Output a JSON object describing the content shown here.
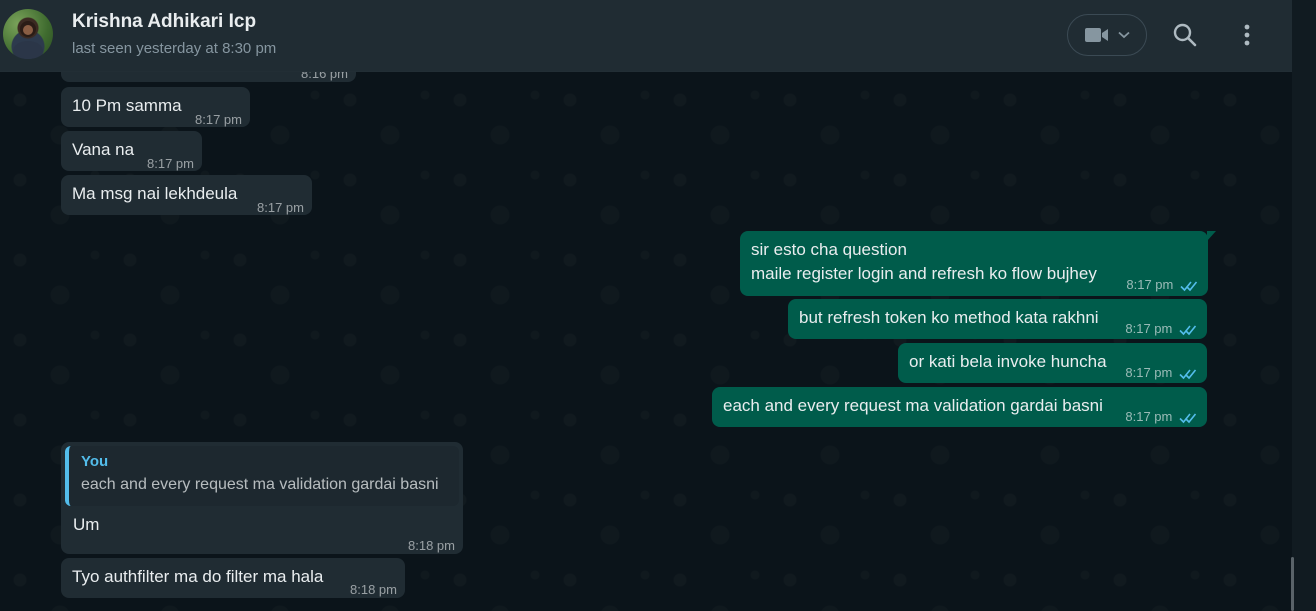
{
  "header": {
    "contact_name": "Krishna Adhikari Icp",
    "status": "last seen yesterday at 8:30 pm",
    "icons": {
      "video": "video-camera-icon",
      "dropdown": "chevron-down-icon",
      "search": "search-icon",
      "menu": "kebab-menu-icon"
    }
  },
  "messages": [
    {
      "dir": "in",
      "text": "10 Pm samma",
      "time": "8:17 pm"
    },
    {
      "dir": "in",
      "text": "Vana na",
      "time": "8:17 pm"
    },
    {
      "dir": "in",
      "text": "Ma msg nai lekhdeula",
      "time": "8:17 pm"
    },
    {
      "dir": "out",
      "line1": "sir esto cha question",
      "text": "maile register login and refresh ko flow bujhey",
      "time": "8:17 pm",
      "status": "read"
    },
    {
      "dir": "out",
      "text": "but refresh token ko method kata rakhni",
      "time": "8:17 pm",
      "status": "read"
    },
    {
      "dir": "out",
      "text": "or kati bela invoke huncha",
      "time": "8:17 pm",
      "status": "read"
    },
    {
      "dir": "out",
      "text": "each and every request ma validation gardai basni",
      "time": "8:17 pm",
      "status": "read"
    },
    {
      "dir": "in",
      "quote_author": "You",
      "quote_text": "each and every request ma validation gardai basni",
      "text": "Um",
      "time": "8:18 pm"
    },
    {
      "dir": "in",
      "text": "Tyo authfilter ma do filter ma hala",
      "time": "8:18 pm"
    }
  ],
  "partial_message": {
    "time": "8:16 pm"
  },
  "colors": {
    "incoming": "#202c33",
    "outgoing": "#005c4b",
    "read_tick": "#53bdeb",
    "background": "#0b141a"
  }
}
